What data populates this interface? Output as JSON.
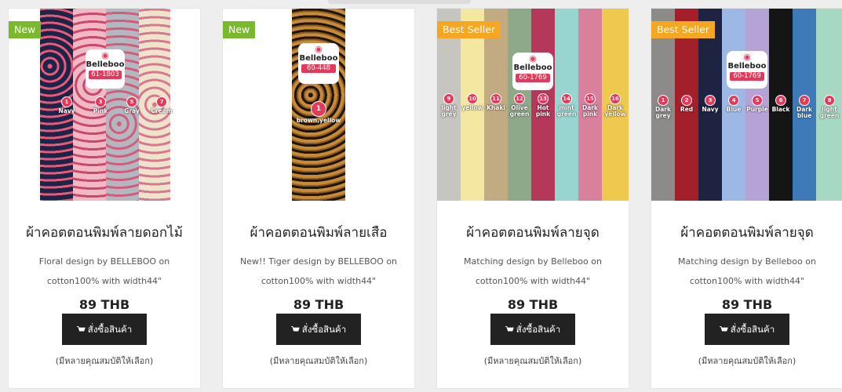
{
  "products": [
    {
      "badge": "New",
      "brand": "Belleboo",
      "code": "61-1803",
      "swatches": [
        "Navy",
        "Pink",
        "Gray",
        "Cream"
      ],
      "swatch_numbers": [
        "1",
        "3",
        "5",
        "7"
      ],
      "title": "ผ้าคอตตอนพิมพ์ลายดอกไม้",
      "desc_line1": "Floral design by BELLEBOO on",
      "desc_line2": "cotton100% with width44\"",
      "price": "89 THB",
      "button": "สั่งซื้อสินค้า",
      "options": "(มีหลายคุณสมบัติให้เลือก)"
    },
    {
      "badge": "New",
      "brand": "Belleboo",
      "code": "60-448",
      "swatches": [
        "brown,yellow"
      ],
      "swatch_numbers": [
        "1"
      ],
      "title": "ผ้าคอตตอนพิมพ์ลายเสือ",
      "desc_line1": "New!! Tiger design by BELLEBOO on",
      "desc_line2": "cotton100% with width44\"",
      "price": "89 THB",
      "button": "สั่งซื้อสินค้า",
      "options": "(มีหลายคุณสมบัติให้เลือก)"
    },
    {
      "badge": "Best Seller",
      "brand": "Belleboo",
      "code": "60-1769",
      "swatches": [
        "light grey",
        "yellow",
        "Khaki",
        "Olive green",
        "Hot pink",
        "mint green",
        "Dark pink",
        "Dark yellow"
      ],
      "swatch_numbers": [
        "9",
        "10",
        "11",
        "12",
        "13",
        "14",
        "15",
        "16"
      ],
      "title": "ผ้าคอตตอนพิมพ์ลายจุด",
      "desc_line1": "Matching design by Belleboo on",
      "desc_line2": "cotton100% with width44\"",
      "price": "89 THB",
      "button": "สั่งซื้อสินค้า",
      "options": "(มีหลายคุณสมบัติให้เลือก)"
    },
    {
      "badge": "Best Seller",
      "brand": "Belleboo",
      "code": "60-1769",
      "swatches": [
        "Dark grey",
        "Red",
        "Navy",
        "Blue",
        "Purple",
        "Black",
        "Dark blue",
        "light green"
      ],
      "swatch_numbers": [
        "1",
        "2",
        "3",
        "4",
        "5",
        "6",
        "7",
        "8"
      ],
      "title": "ผ้าคอตตอนพิมพ์ลายจุด",
      "desc_line1": "Matching design by Belleboo on",
      "desc_line2": "cotton100% with width44\"",
      "price": "89 THB",
      "button": "สั่งซื้อสินค้า",
      "options": "(มีหลายคุณสมบัติให้เลือก)"
    }
  ],
  "colors": {
    "badge_new": "#7ab82d",
    "badge_best": "#f5a623",
    "button_bg": "#222222",
    "brand_pink": "#e33a5b"
  },
  "icons": {
    "button_icon": "shopping-cart-icon"
  }
}
